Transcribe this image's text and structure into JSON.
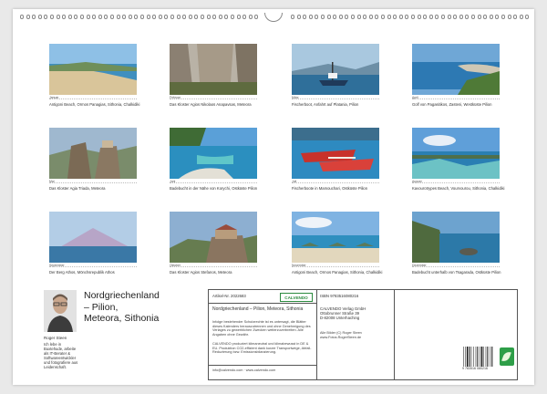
{
  "title": "Nordgriechenland – Pilion, Meteora, Sithonia",
  "title_lines": [
    "Nordgriechenland",
    "– Pilion,",
    "Meteora, Sithonia"
  ],
  "months": [
    {
      "month": "Januar",
      "caption": "Antigoni Beach, Ormos Panagias, Sithonia, Chalkidiki",
      "scene": "beach"
    },
    {
      "month": "Februar",
      "caption": "Das Kloster Agios Nikolaos Anapavsas, Meteora",
      "scene": "rock"
    },
    {
      "month": "März",
      "caption": "Fischerboot, Anfahrt auf Platania, Pilion",
      "scene": "boat"
    },
    {
      "month": "April",
      "caption": "Golf von Pagasitikos, Zasteni, Westküste Pilion",
      "scene": "gulf"
    },
    {
      "month": "Mai",
      "caption": "Das Kloster Agia Triada, Meteora",
      "scene": "monastery"
    },
    {
      "month": "Juni",
      "caption": "Badebucht in der Nähe von Korychi, Ostküste Pilion",
      "scene": "bay"
    },
    {
      "month": "Juli",
      "caption": "Fischerboote in Mamouchari, Ostküste Pilion",
      "scene": "redboats"
    },
    {
      "month": "August",
      "caption": "Kavourotrypes Beach, Vourvourou, Sithonia, Chalkidiki",
      "scene": "sea"
    },
    {
      "month": "September",
      "caption": "Der Berg Athos, Mönchsrepublik Athos",
      "scene": "athos"
    },
    {
      "month": "Oktober",
      "caption": "Das Kloster Agios Stefanos, Meteora",
      "scene": "kloster"
    },
    {
      "month": "November",
      "caption": "Antigoni Beach, Ormos Panagias, Sithonia, Chalkidiki",
      "scene": "umbrellas"
    },
    {
      "month": "Dezember",
      "caption": "Badebucht unterhalb von Tsagarada, Ostküste Pilion",
      "scene": "coast"
    }
  ],
  "author": {
    "name": "Roger Steen",
    "bio": "Ich lebe in Buxtehude, arbeite als IT-Berater & Softwareentwickler und fotografiere aus Leidenschaft."
  },
  "info": {
    "article_no": "Artikel-Nr. 2022683",
    "isbn": "ISBN 9783516080216",
    "subtitle": "Nordgriechenland – Pilion, Meteora, Sithonia",
    "description_1": "Infolge bestehender Schutzrechte ist es untersagt, die Blätter dieses Kalenders herauszutrennen und ohne Genehmigung des Verlages zu gewerblichen Zwecken weiterzuverbreiten. Alle Angaben ohne Gewähr.",
    "description_2": "CALVENDO produziert klimaneutral und klimabewusst in DE & EU. Produktion CO2-effizient dank kurzer Transportwege, Abfall-Reduzierung bzw. Emissionsbilanzierung.",
    "publisher_name": "CALVENDO Verlag GmbH",
    "publisher_street": "Ottobrunner Straße 39",
    "publisher_city": "D-82008 Unterhaching",
    "credits_1": "Alle Bilder (C) Roger Steen",
    "credits_2": "www.Fotos.RogerSteen.de",
    "contact": "info@calvendo.com · www.calvendo.com",
    "logo": "CALVENDO",
    "barcode_number": "9 783516 080216"
  },
  "colors": {
    "publisher_green": "#2e9e48"
  }
}
